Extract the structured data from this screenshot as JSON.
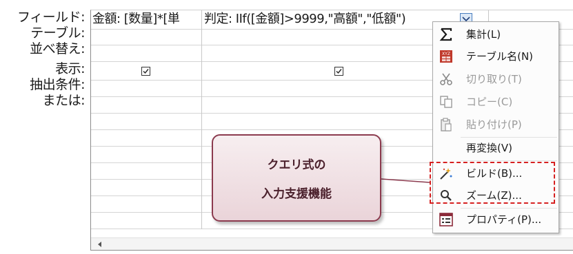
{
  "row_labels": [
    "フィールド:",
    "テーブル:",
    "並べ替え:",
    "表示:",
    "抽出条件:",
    "または:"
  ],
  "grid": {
    "col1_field": "金額: [数量]*[単",
    "col2_field": "判定: IIf([金額]>9999,\"高額\",\"低額\")",
    "col1_show": true,
    "col2_show": true
  },
  "context_menu": {
    "items": [
      {
        "label": "集計(L)",
        "icon": "sigma-icon",
        "enabled": true
      },
      {
        "label": "テーブル名(N)",
        "icon": "table-name-icon",
        "enabled": true
      },
      {
        "label": "切り取り(T)",
        "icon": "scissors-icon",
        "enabled": false
      },
      {
        "label": "コピー(C)",
        "icon": "copy-icon",
        "enabled": false
      },
      {
        "label": "貼り付け(P)",
        "icon": "paste-icon",
        "enabled": false
      },
      {
        "label": "再変換(V)",
        "icon": "",
        "enabled": true
      },
      {
        "label": "ビルド(B)...",
        "icon": "build-wand-icon",
        "enabled": true
      },
      {
        "label": "ズーム(Z)...",
        "icon": "magnifier-icon",
        "enabled": true
      },
      {
        "label": "プロパティ(P)...",
        "icon": "properties-icon",
        "enabled": true
      }
    ]
  },
  "callout": {
    "line1": "クエリ式の",
    "line2": "入力支援機能"
  },
  "colors": {
    "highlight_border": "#d62020",
    "callout_border": "#8b3a4e",
    "callout_fill": "#ead4d9"
  }
}
